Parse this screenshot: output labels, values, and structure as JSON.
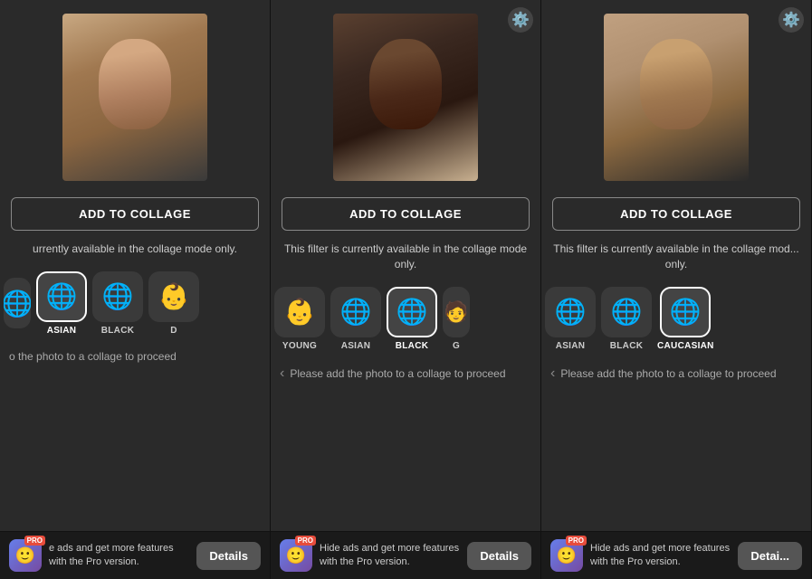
{
  "panels": [
    {
      "id": "panel-1",
      "hasGear": false,
      "addCollageLabel": "ADD TO COLLAGE",
      "filterDescription": "urrently available in the collage mode only.",
      "filters": [
        {
          "id": "f1p1",
          "emoji": "🌐",
          "label": "ASIAN",
          "selected": true,
          "partial": true
        },
        {
          "id": "f2p1",
          "emoji": "🌐",
          "label": "BLACK",
          "selected": false
        },
        {
          "id": "f3p1",
          "emoji": "👶",
          "label": "D",
          "selected": false,
          "partial": true
        }
      ],
      "proceedText": "o the photo to a collage to proceed",
      "showChevron": false,
      "promo": {
        "text": "e ads and get more features with the Pro version.",
        "showIcon": true,
        "detailsLabel": "Details"
      }
    },
    {
      "id": "panel-2",
      "hasGear": true,
      "addCollageLabel": "ADD TO COLLAGE",
      "filterDescription": "This filter is currently available in the collage mode only.",
      "filters": [
        {
          "id": "f1p2",
          "emoji": "👶",
          "label": "YOUNG",
          "selected": false
        },
        {
          "id": "f2p2",
          "emoji": "🌐",
          "label": "ASIAN",
          "selected": false
        },
        {
          "id": "f3p2",
          "emoji": "🌐",
          "label": "BLACK",
          "selected": true
        },
        {
          "id": "f4p2",
          "emoji": "🧑",
          "label": "G",
          "selected": false,
          "partial": true
        }
      ],
      "proceedText": "Please add the photo to a collage to proceed",
      "showChevron": true,
      "promo": {
        "text": "Hide ads and get more features with the Pro version.",
        "showIcon": true,
        "detailsLabel": "Details"
      }
    },
    {
      "id": "panel-3",
      "hasGear": true,
      "addCollageLabel": "ADD TO COLLAGE",
      "filterDescription": "This filter is currently available in the collage mod... only.",
      "filters": [
        {
          "id": "f1p3",
          "emoji": "🌐",
          "label": "ASIAN",
          "selected": false
        },
        {
          "id": "f2p3",
          "emoji": "🌐",
          "label": "BLACK",
          "selected": false
        },
        {
          "id": "f3p3",
          "emoji": "🌐",
          "label": "CAUCASIAN",
          "selected": true
        }
      ],
      "proceedText": "Please add the photo to a collage to proceed",
      "showChevron": true,
      "promo": {
        "text": "Hide ads and get more features with the Pro version.",
        "showIcon": true,
        "detailsLabel": "Detai..."
      }
    }
  ]
}
